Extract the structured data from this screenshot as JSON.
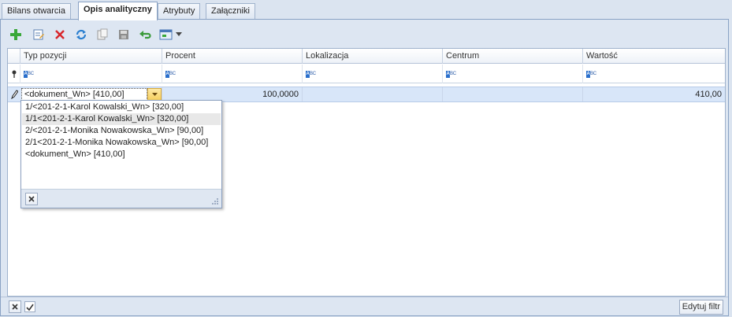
{
  "tabs": [
    {
      "label": "Bilans otwarcia",
      "active": false
    },
    {
      "label": "Opis analityczny",
      "active": true
    },
    {
      "label": "Atrybuty",
      "active": false
    },
    {
      "label": "Załączniki",
      "active": false
    }
  ],
  "toolbar": {
    "icons": [
      "add-icon",
      "edit-icon",
      "delete-icon",
      "refresh-icon",
      "copy-icon",
      "save-icon",
      "undo-icon",
      "view-icon",
      "dropdown-arrow-icon"
    ]
  },
  "grid": {
    "columns": [
      "Typ pozycji",
      "Procent",
      "Lokalizacja",
      "Centrum",
      "Wartość"
    ],
    "row": {
      "typ": "<dokument_Wn> [410,00]",
      "procent": "100,0000",
      "lokalizacja": "",
      "centrum": "",
      "wartosc": "410,00"
    }
  },
  "dropdown": {
    "items": [
      "1/<201-2-1-Karol Kowalski_Wn> [320,00]",
      "1/1<201-2-1-Karol Kowalski_Wn> [320,00]",
      "2/<201-2-1-Monika Nowakowska_Wn> [90,00]",
      "2/1<201-2-1-Monika Nowakowska_Wn> [90,00]",
      "<dokument_Wn> [410,00]"
    ],
    "highlighted_index": 1
  },
  "footer": {
    "edit_filter_label": "Edytuj filtr"
  },
  "colors": {
    "accent": "#2a6fcc",
    "selected_row": "#d8e6f9",
    "add_green": "#3aa83a",
    "delete_red": "#d8262b"
  }
}
